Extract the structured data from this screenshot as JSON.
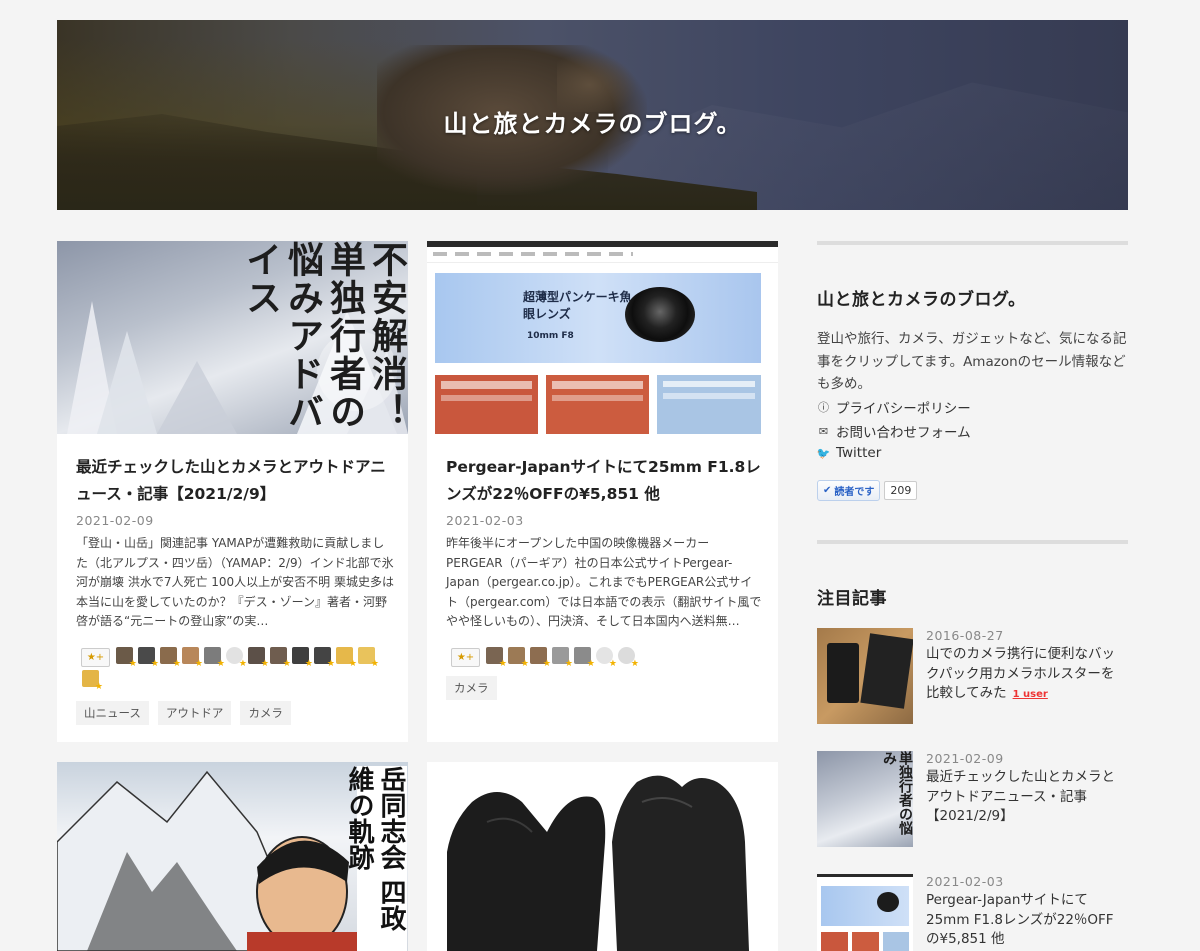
{
  "site": {
    "title": "山と旅とカメラのブログ。"
  },
  "posts": [
    {
      "title": "最近チェックした山とカメラとアウトドアニュース・記事【2021/2/9】",
      "date": "2021-02-09",
      "excerpt": "「登山・山岳」関連記事 YAMAPが遭難救助に貢献しました（北アルプス・四ツ岳）（YAMAP：2/9）インド北部で氷河が崩壊 洪水で7人死亡 100人以上が安否不明 栗城史多は本当に山を愛していたのか？『デス・ゾーン』著者・河野啓が語る“元ニートの登山家”の実…",
      "tags": [
        "山ニュース",
        "アウトドア",
        "カメラ"
      ],
      "thumb_text": "不安解消！単独行者の悩みアドバイス"
    },
    {
      "title": "Pergear-Japanサイトにて25mm F1.8レンズが22％OFFの¥5,851 他",
      "date": "2021-02-03",
      "excerpt": "昨年後半にオープンした中国の映像機器メーカーPERGEAR（パーギア）社の日本公式サイトPergear-Japan（pergear.co.jp）。これまでもPERGEAR公式サイト（pergear.com）では日本語での表示（翻訳サイト風でやや怪しいもの）、円決済、そして日本国内へ送料無…",
      "tags": [
        "カメラ"
      ],
      "thumb_banner": "超薄型パンケーキ魚眼レンズ",
      "thumb_banner_sub": "10mm F8"
    },
    {
      "thumb_text": "岳同志会 四政維の軌跡"
    },
    {
      "thumb_text": ""
    }
  ],
  "star_button_label": "★+",
  "sidebar": {
    "about_title": "山と旅とカメラのブログ。",
    "about_desc": "登山や旅行、カメラ、ガジェットなど、気になる記事をクリップしてます。Amazonのセール情報なども多め。",
    "links": [
      "プライバシーポリシー",
      "お問い合わせフォーム",
      "Twitter"
    ],
    "reader_label": "読者です",
    "reader_count": "209",
    "popular_title": "注目記事",
    "popular": [
      {
        "date": "2016-08-27",
        "title": "山でのカメラ携行に便利なバックパック用カメラホルスターを比較してみた",
        "bookmark": "1 user"
      },
      {
        "date": "2021-02-09",
        "title": "最近チェックした山とカメラとアウトドアニュース・記事【2021/2/9】"
      },
      {
        "date": "2021-02-03",
        "title": "Pergear-Japanサイトにて25mm F1.8レンズが22％OFFの¥5,851 他"
      }
    ]
  }
}
